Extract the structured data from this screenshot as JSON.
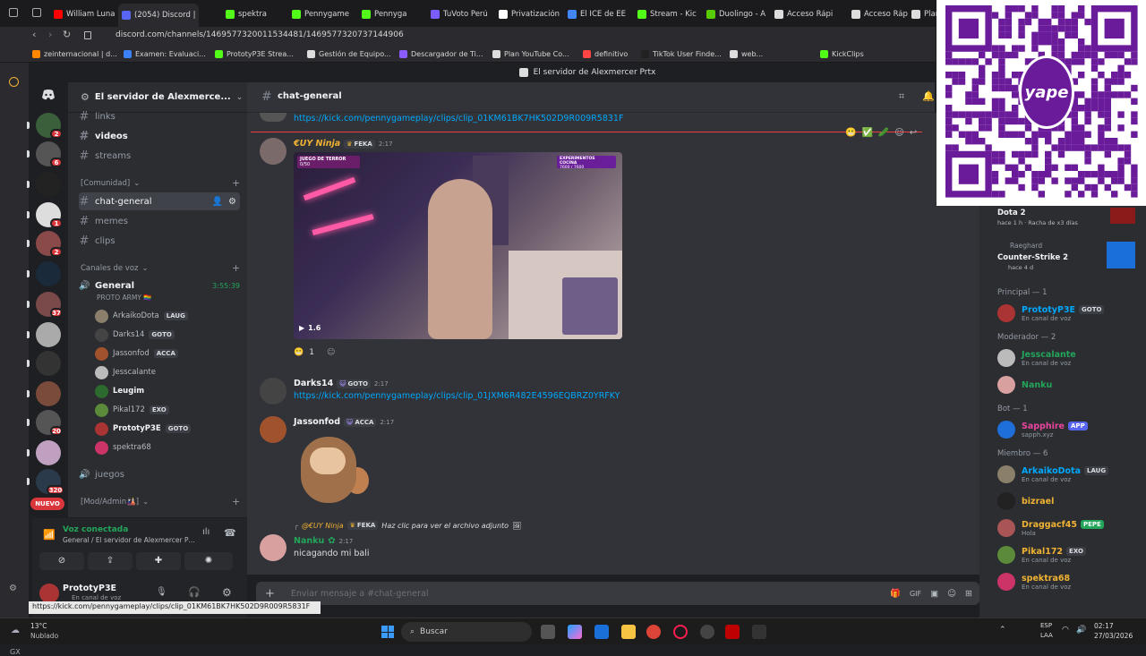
{
  "browser": {
    "tabs": [
      {
        "label": "William Luna",
        "color": "#ff0000",
        "active": false
      },
      {
        "label": "(2054) Discord | #",
        "color": "#5865f2",
        "active": true
      },
      {
        "label": "spektra",
        "color": "#53fc18",
        "active": false
      },
      {
        "label": "Pennygame",
        "color": "#53fc18",
        "active": false
      },
      {
        "label": "Pennyga",
        "color": "#53fc18",
        "active": false
      },
      {
        "label": "TuVoto Perú",
        "color": "#7b5cff",
        "active": false
      },
      {
        "label": "Privatización",
        "color": "#ffffff",
        "active": false
      },
      {
        "label": "El ICE de EE",
        "color": "#4285f4",
        "active": false
      },
      {
        "label": "Stream - Kic",
        "color": "#53fc18",
        "active": false
      },
      {
        "label": "Duolingo - A",
        "color": "#58cc02",
        "active": false
      },
      {
        "label": "Acceso Rápi",
        "color": "#dddddd",
        "active": false
      },
      {
        "label": "Acceso Ráp",
        "color": "#dddddd",
        "active": false
      },
      {
        "label": "Plan",
        "color": "#dddddd",
        "active": false
      }
    ],
    "url": "discord.com/channels/1469577320011534481/1469577320737144906",
    "bookmarks": [
      {
        "label": "zeinternacional | d...",
        "color": "#ff8800"
      },
      {
        "label": "Examen: Evaluaci...",
        "color": "#3b82f6"
      },
      {
        "label": "PrototyP3E Strea...",
        "color": "#53fc18"
      },
      {
        "label": "Gestión de Equipo...",
        "color": "#dddddd"
      },
      {
        "label": "Descargador de Ti...",
        "color": "#8a5cff"
      },
      {
        "label": "Plan YouTube Co...",
        "color": "#dddddd"
      },
      {
        "label": "definitivo",
        "color": "#ff4444"
      },
      {
        "label": "TikTok User Finde...",
        "color": "#222222"
      },
      {
        "label": "web...",
        "color": "#dddddd"
      },
      {
        "label": "KickClips",
        "color": "#53fc18"
      }
    ],
    "status_url": "https://kick.com/pennygameplay/clips/clip_01KM61BK7HK502D9R009R5831F"
  },
  "discord": {
    "window_title": "El servidor de Alexmercer Prtx",
    "server_name": "El servidor de Alexmerce...",
    "channels_top": [
      {
        "name": "links",
        "unread": false
      },
      {
        "name": "videos",
        "unread": true
      },
      {
        "name": "streams",
        "unread": false
      }
    ],
    "category_comunidad": "[Comunidad]",
    "channels_comunidad": [
      {
        "name": "chat-general",
        "selected": true
      },
      {
        "name": "memes",
        "selected": false
      },
      {
        "name": "clips",
        "selected": false
      }
    ],
    "category_voice": "Canales de voz",
    "voice_channel": "General",
    "voice_timer": "3:55:39",
    "voice_subtitle": "PROTO ARMY 🏳️‍🌈",
    "voice_users": [
      {
        "name": "ArkaikoDota",
        "tag": "LAUG",
        "color": "#8a7f6a"
      },
      {
        "name": "Darks14",
        "tag": "GOTO",
        "color": "#444"
      },
      {
        "name": "Jassonfod",
        "tag": "ACCA",
        "color": "#a0522d"
      },
      {
        "name": "Jesscalante",
        "tag": "",
        "color": "#bbb"
      },
      {
        "name": "Leugim",
        "tag": "",
        "color": "#2d6a2d"
      },
      {
        "name": "Pikal172",
        "tag": "EXO",
        "color": "#5a8a3a"
      },
      {
        "name": "PrototyP3E",
        "tag": "GOTO",
        "color": "#aa3333"
      },
      {
        "name": "spektra68",
        "tag": "",
        "color": "#cc3366"
      }
    ],
    "channel_juegos": "juegos",
    "category_mod": "[Mod/Admin🎎]",
    "voice_status": "Voz conectada",
    "voice_location": "General / El servidor de Alexmercer Prtx",
    "current_user": "PrototyP3E",
    "current_user_status": "En canal de voz",
    "header_channel": "chat-general",
    "new_badge": "NUEVO",
    "server_badges": [
      "2",
      "6",
      "1",
      "2",
      "37",
      "20",
      "320"
    ]
  },
  "messages": {
    "m0_link": "https://kick.com/pennygameplay/clips/clip_01KM61BK7HK502D9R009R5831F",
    "m1": {
      "author": "€UY Ninja",
      "tag": "FEKA",
      "time": "2:17",
      "video_left": "JUEGO DE TERROR",
      "video_left_sub": "0/50",
      "video_right": "EXPERIMENTOS COCINA",
      "video_right_sub": "7600 / 7600",
      "video_duration": "1.6",
      "reaction_count": "1"
    },
    "m2": {
      "author": "Darks14",
      "tag": "GOTO",
      "time": "2:17",
      "link": "https://kick.com/pennygameplay/clips/clip_01JXM6R482E4596EQBRZ0YRFKY"
    },
    "m3": {
      "author": "Jassonfod",
      "tag": "ACCA",
      "time": "2:17"
    },
    "m4": {
      "reply_author": "@€UY Ninja",
      "reply_tag": "FEKA",
      "reply_text": "Haz clic para ver el archivo adjunto",
      "author": "Nanku",
      "time": "2:17",
      "text": "nicagando mi bali"
    },
    "composer_placeholder": "Enviar mensaje a #chat-general"
  },
  "members": {
    "activities": [
      {
        "game": "Dota 2",
        "detail": "hace 1 h · Racha de x3 días"
      },
      {
        "game": "Counter-Strike 2",
        "user": "Raeghard",
        "detail": "hace 4 d"
      }
    ],
    "groups": [
      {
        "title": "Principal — 1",
        "members": [
          {
            "name": "PrototyP3E",
            "tag": "GOTO",
            "status": "En canal de voz",
            "color": "#00a8fc",
            "avatar": "#aa3333"
          }
        ]
      },
      {
        "title": "Moderador — 2",
        "members": [
          {
            "name": "Jesscalante",
            "tag": "",
            "status": "En canal de voz",
            "color": "#23a55a",
            "avatar": "#bbbbbb"
          },
          {
            "name": "Nanku",
            "tag": "",
            "status": "",
            "color": "#23a55a",
            "avatar": "#d9a0a0"
          }
        ]
      },
      {
        "title": "Bot — 1",
        "members": [
          {
            "name": "Sapphire",
            "tag": "APP",
            "status": "sapph.xyz",
            "color": "#eb459e",
            "avatar": "#1e6fd9"
          }
        ]
      },
      {
        "title": "Miembro — 6",
        "members": [
          {
            "name": "ArkaikoDota",
            "tag": "LAUG",
            "status": "En canal de voz",
            "color": "#00a8fc",
            "avatar": "#8a7f6a"
          },
          {
            "name": "bizrael",
            "tag": "",
            "status": "",
            "color": "#f0b232",
            "avatar": "#222"
          },
          {
            "name": "Draggacf45",
            "tag": "PEPE",
            "status": "Hola",
            "color": "#f0b232",
            "avatar": "#aa5555"
          },
          {
            "name": "Pikal172",
            "tag": "EXO",
            "status": "En canal de voz",
            "color": "#f0b232",
            "avatar": "#5a8a3a"
          },
          {
            "name": "spektra68",
            "tag": "",
            "status": "En canal de voz",
            "color": "#f0b232",
            "avatar": "#cc3366"
          }
        ]
      }
    ]
  },
  "taskbar": {
    "weather_temp": "13°C",
    "weather_desc": "Nublado",
    "search": "Buscar",
    "lang": "ESP",
    "lang2": "LAA",
    "time": "02:17",
    "date": "27/03/2026"
  },
  "qr": {
    "brand": "yape"
  }
}
